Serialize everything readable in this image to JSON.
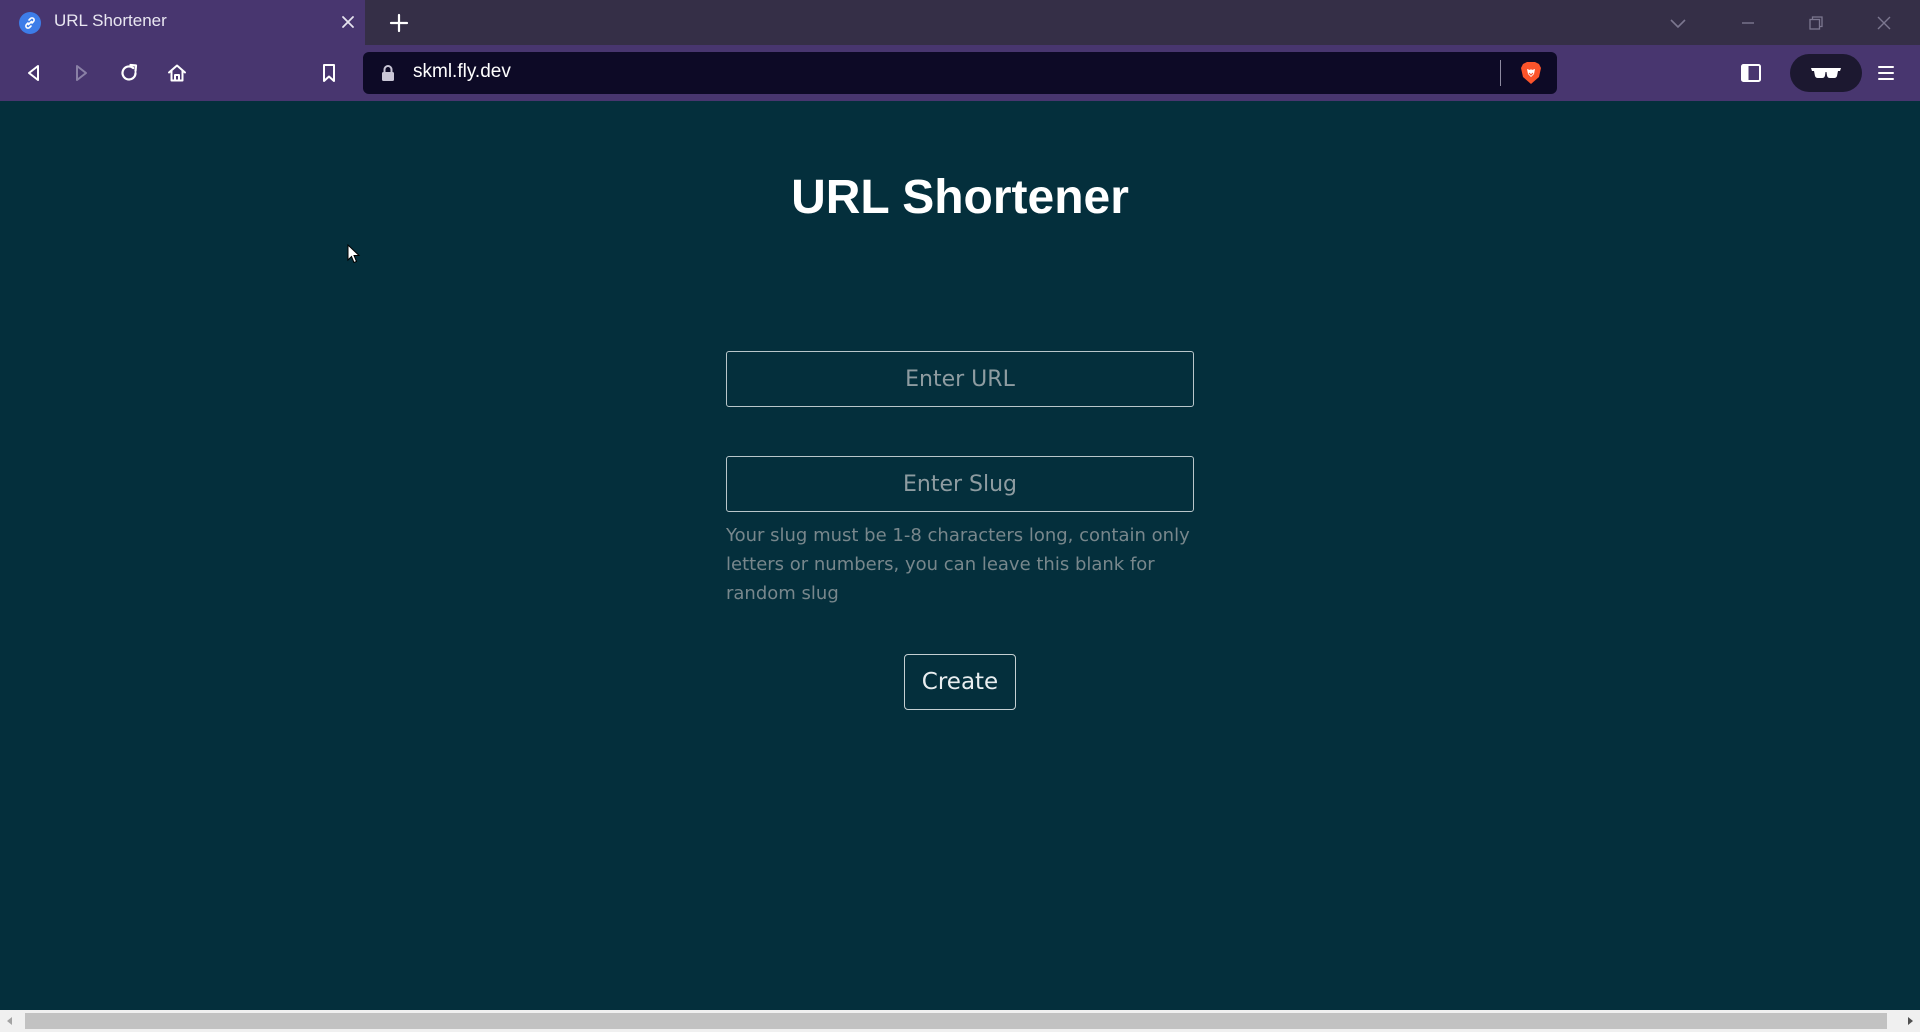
{
  "browser": {
    "tab_title": "URL Shortener",
    "address": "skml.fly.dev",
    "icons": {
      "tab_favicon": "link-icon",
      "tab_close": "close-icon",
      "new_tab": "plus-icon",
      "tab_search": "chevron-down-icon",
      "window_min": "minimize-icon",
      "window_max": "restore-icon",
      "window_close": "close-icon",
      "back": "back-arrow-icon",
      "forward": "forward-arrow-icon",
      "reload": "reload-icon",
      "home": "home-icon",
      "bookmark": "bookmark-icon",
      "lock": "lock-icon",
      "brave_shields": "brave-lion-icon",
      "sidebar": "sidebar-icon",
      "vpn": "glasses-icon",
      "menu": "hamburger-menu-icon"
    },
    "colors": {
      "tab_strip": "#352f47",
      "toolbar": "#48366f",
      "address_bar": "#0d0a26",
      "brave_accent": "#fb542b"
    }
  },
  "page": {
    "title": "URL Shortener",
    "url_input": {
      "placeholder": "Enter URL",
      "value": ""
    },
    "slug_input": {
      "placeholder": "Enter Slug",
      "value": ""
    },
    "slug_help": "Your slug must be 1-8 characters long, contain only letters or numbers, you can leave this blank for random slug",
    "create_label": "Create",
    "colors": {
      "background": "#042f3c",
      "title": "#ffffff",
      "input_border": "#b9c6ca",
      "help_text": "#78878c"
    }
  }
}
